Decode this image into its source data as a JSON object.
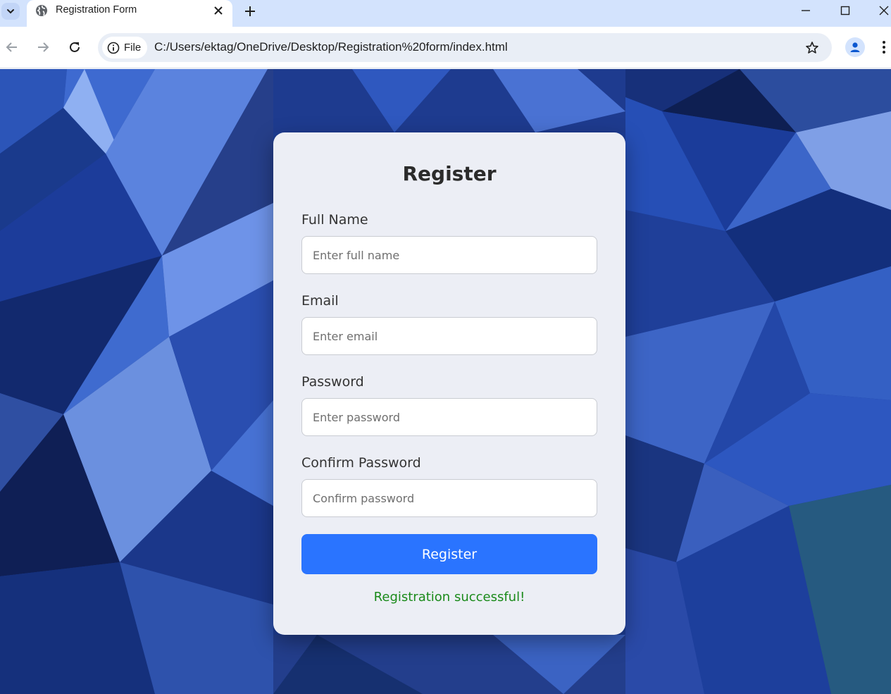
{
  "browser": {
    "tab_title": "Registration Form",
    "chip_label": "File",
    "url": "C:/Users/ektag/OneDrive/Desktop/Registration%20form/index.html"
  },
  "form": {
    "title": "Register",
    "fields": [
      {
        "label": "Full Name",
        "placeholder": "Enter full name"
      },
      {
        "label": "Email",
        "placeholder": "Enter email"
      },
      {
        "label": "Password",
        "placeholder": "Enter password"
      },
      {
        "label": "Confirm Password",
        "placeholder": "Confirm password"
      }
    ],
    "submit_label": "Register",
    "status_message": "Registration successful!"
  },
  "colors": {
    "accent": "#2a74ff",
    "success": "#1a8a1a",
    "background": "#1b3a8a"
  },
  "icons": [
    "tab-list-icon",
    "globe-icon",
    "close-icon",
    "plus-icon",
    "minimize-icon",
    "maximize-icon",
    "window-close-icon",
    "back-icon",
    "forward-icon",
    "reload-icon",
    "info-icon",
    "star-icon",
    "profile-icon",
    "more-icon"
  ]
}
